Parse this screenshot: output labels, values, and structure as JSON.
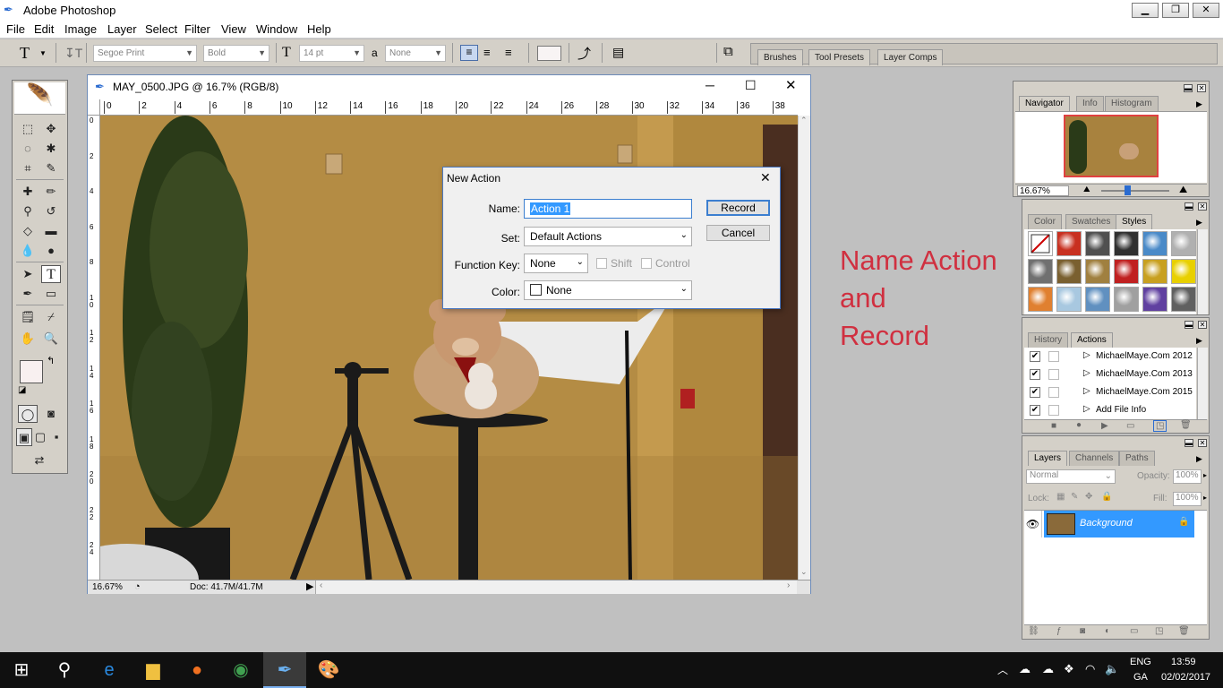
{
  "app": {
    "title": "Adobe Photoshop"
  },
  "menu": [
    "File",
    "Edit",
    "Image",
    "Layer",
    "Select",
    "Filter",
    "View",
    "Window",
    "Help"
  ],
  "options_bar": {
    "font_family": "Segoe Print",
    "font_style": "Bold",
    "font_size": "14 pt",
    "aa_label": "a",
    "anti_alias": "None",
    "tab_wells": [
      "Brushes",
      "Tool Presets",
      "Layer Comps"
    ]
  },
  "document": {
    "title": "MAY_0500.JPG @ 16.7% (RGB/8)",
    "zoom": "16.67%",
    "doc_size": "Doc: 41.7M/41.7M",
    "ruler_top": [
      "0",
      "2",
      "4",
      "6",
      "8",
      "10",
      "12",
      "14",
      "16",
      "18",
      "20",
      "22",
      "24",
      "26",
      "28",
      "30",
      "32",
      "34",
      "36",
      "38"
    ],
    "ruler_left": [
      "0",
      "2",
      "4",
      "6",
      "8",
      "1 0",
      "1 2",
      "1 4",
      "1 6",
      "1 8",
      "2 0",
      "2 2",
      "2 4"
    ]
  },
  "dialog": {
    "title": "New Action",
    "name_label": "Name:",
    "name_value": "Action 1",
    "set_label": "Set:",
    "set_value": "Default Actions",
    "fkey_label": "Function Key:",
    "fkey_value": "None",
    "shift_label": "Shift",
    "control_label": "Control",
    "color_label": "Color:",
    "color_value": "None",
    "record_button": "Record",
    "cancel_button": "Cancel"
  },
  "navigator": {
    "tabs": [
      "Navigator",
      "Info",
      "Histogram"
    ],
    "zoom": "16.67%"
  },
  "styles_panel": {
    "tabs": [
      "Color",
      "Swatches",
      "Styles"
    ],
    "swatch_colors": [
      "#ffffff",
      "#c83020",
      "#505050",
      "#303030",
      "#4a8ac8",
      "#b0b0b0",
      "#707070",
      "#7a6030",
      "#a08040",
      "#c02020",
      "#c8a020",
      "#e8d000",
      "#e08030",
      "#a8c8e0",
      "#6090c0",
      "#a0a0a0",
      "#6040a0",
      "#606060"
    ]
  },
  "actions_panel": {
    "tabs": [
      "History",
      "Actions"
    ],
    "items": [
      "MichaelMaye.Com 2012",
      "MichaelMaye.Com 2013",
      "MichaelMaye.Com 2015",
      "Add File Info"
    ]
  },
  "layers_panel": {
    "tabs": [
      "Layers",
      "Channels",
      "Paths"
    ],
    "blend_mode": "Normal",
    "opacity_label": "Opacity:",
    "opacity": "100%",
    "lock_label": "Lock:",
    "fill_label": "Fill:",
    "fill": "100%",
    "layers": [
      {
        "name": "Background"
      }
    ]
  },
  "annotation": {
    "line1": "Name Action",
    "line2": "and",
    "line3": "Record"
  },
  "taskbar": {
    "lang1": "ENG",
    "lang2": "GA",
    "time": "13:59",
    "date": "02/02/2017"
  },
  "colors": {
    "accent": "#3399ff",
    "annotation": "#d03040",
    "selection": "#3399ff"
  }
}
